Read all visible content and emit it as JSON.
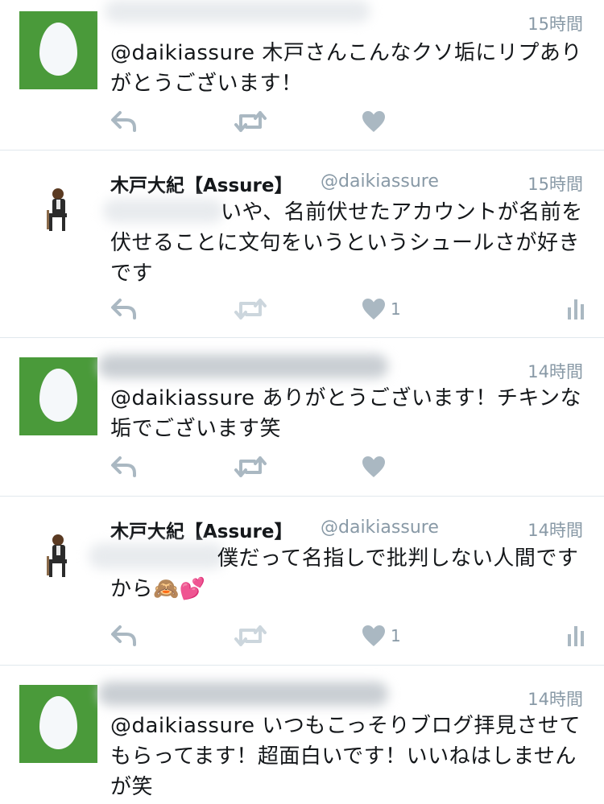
{
  "tweets": [
    {
      "time": "15時間",
      "text": "@daikiassure 木戸さんこんなクソ垢にリプありがとうございます！"
    },
    {
      "name": "木戸大紀【Assure】",
      "handle": "@daikiassure",
      "time": "15時間",
      "text": "いや、名前伏せたアカウントが名前を伏せることに文句をいうというシュールさが好きです",
      "like_count": "1"
    },
    {
      "time": "14時間",
      "text": "@daikiassure ありがとうございます！チキンな垢でございます笑"
    },
    {
      "name": "木戸大紀【Assure】",
      "handle": "@daikiassure",
      "time": "14時間",
      "text": "僕だって名指しで批判しない人間ですから🙈💕",
      "like_count": "1"
    },
    {
      "time": "14時間",
      "text": "@daikiassure いつもこっそりブログ拝見させてもらってます！超面白いです！いいねはしませんが笑"
    }
  ],
  "colors": {
    "icon_gray": "#aab8c2",
    "icon_light": "#ccd6dd",
    "egg_green": "#4a9a3a",
    "secondary_text": "#8899a6"
  }
}
